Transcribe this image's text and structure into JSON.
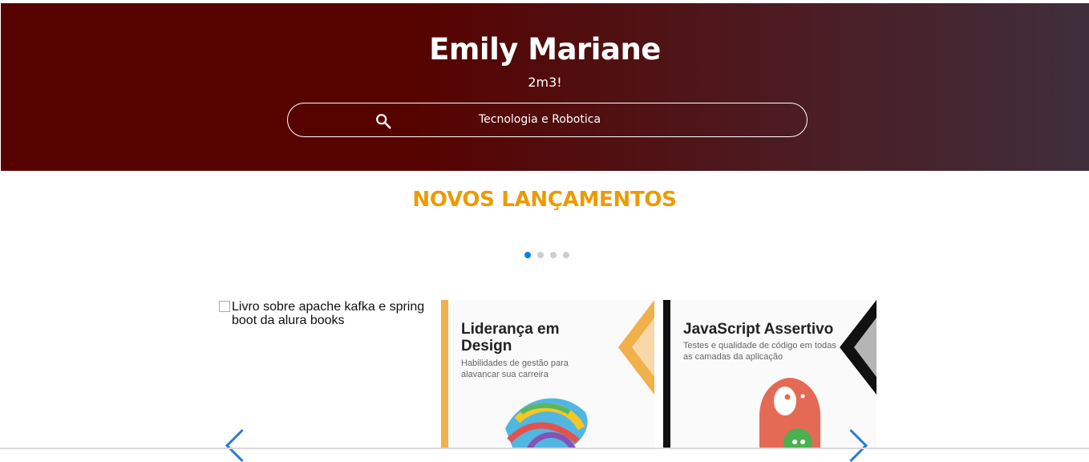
{
  "header": {
    "title": "Emily Mariane",
    "subtitle": "2m3!",
    "search": {
      "value": "Tecnologia e Robotica",
      "icon": "search-icon"
    }
  },
  "section": {
    "title": "NOVOS LANÇAMENTOS",
    "pagination": {
      "count": 4,
      "active": 1
    }
  },
  "books": [
    {
      "alt": "Livro sobre apache kafka e spring boot da alura books"
    },
    {
      "title": "Liderança em Design",
      "subtitle": "Habilidades de gestão para alavancar sua carreira",
      "accent": "#f0b04a"
    },
    {
      "title": "JavaScript Assertivo",
      "subtitle": "Testes e qualidade de código em todas as camadas da aplicação",
      "accent": "#111111"
    }
  ],
  "colors": {
    "header_dark": "#560300",
    "header_light": "#3f2f3c",
    "section_title": "#eb9b00",
    "dot_active": "#0d7bf2"
  }
}
